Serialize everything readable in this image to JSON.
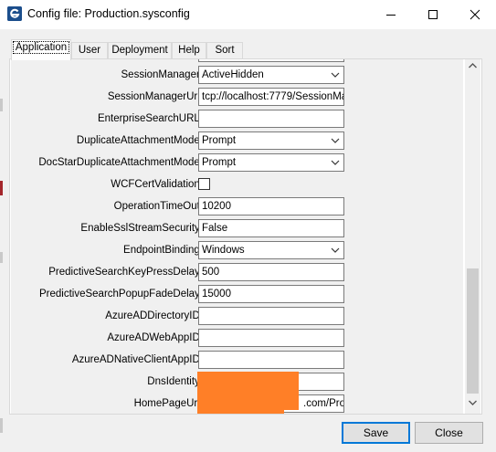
{
  "window": {
    "title": "Config file: Production.sysconfig",
    "minimize_glyph": "—",
    "maximize_glyph": "☐",
    "close_glyph": "✕"
  },
  "tabs": [
    {
      "label": "Application",
      "active": true
    },
    {
      "label": "User",
      "active": false
    },
    {
      "label": "Deployment",
      "active": false
    },
    {
      "label": "Help",
      "active": false
    },
    {
      "label": "Sort",
      "active": false
    }
  ],
  "settings": [
    {
      "label": "SessionManager:",
      "type": "combo",
      "value": "ActiveHidden"
    },
    {
      "label": "SessionManagerUri:",
      "type": "text",
      "value": "tcp://localhost:7779/SessionMa"
    },
    {
      "label": "EnterpriseSearchURL:",
      "type": "text",
      "value": ""
    },
    {
      "label": "DuplicateAttachmentMode:",
      "type": "combo",
      "value": "Prompt"
    },
    {
      "label": "DocStarDuplicateAttachmentMode:",
      "type": "combo",
      "value": "Prompt"
    },
    {
      "label": "WCFCertValidation:",
      "type": "checkbox",
      "checked": false
    },
    {
      "label": "OperationTimeOut:",
      "type": "text",
      "value": "10200"
    },
    {
      "label": "EnableSslStreamSecurity:",
      "type": "text",
      "value": "False"
    },
    {
      "label": "EndpointBinding:",
      "type": "combo",
      "value": "Windows"
    },
    {
      "label": "PredictiveSearchKeyPressDelay:",
      "type": "text",
      "value": "500"
    },
    {
      "label": "PredictiveSearchPopupFadeDelay:",
      "type": "text",
      "value": "15000"
    },
    {
      "label": "AzureADDirectoryID:",
      "type": "text",
      "value": ""
    },
    {
      "label": "AzureADWebAppID:",
      "type": "text",
      "value": ""
    },
    {
      "label": "AzureADNativeClientAppID:",
      "type": "text",
      "value": ""
    },
    {
      "label": "DnsIdentity:",
      "type": "text",
      "value": ""
    },
    {
      "label": "HomePageUrl:",
      "type": "text",
      "value": ".com/Proc"
    }
  ],
  "buttons": {
    "save": "Save",
    "close": "Close"
  },
  "colors": {
    "accent": "#0078d7",
    "redaction": "#ff7f27"
  }
}
